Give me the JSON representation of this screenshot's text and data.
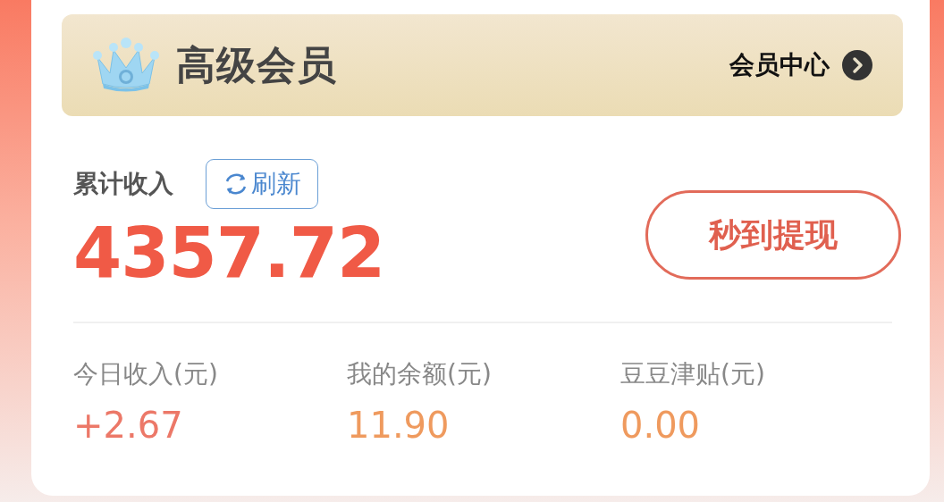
{
  "member_banner": {
    "title": "高级会员",
    "link": "会员中心"
  },
  "income": {
    "label": "累计收入",
    "refresh_button": "刷新",
    "total": "4357.72",
    "withdraw_button": "秒到提现"
  },
  "stats": [
    {
      "label": "今日收入(元)",
      "value": "+2.67",
      "color": "#ec7868"
    },
    {
      "label": "我的余额(元)",
      "value": "11.90",
      "color": "#ef9a5e"
    },
    {
      "label": "豆豆津贴(元)",
      "value": "0.00",
      "color": "#ef9a5e"
    }
  ]
}
